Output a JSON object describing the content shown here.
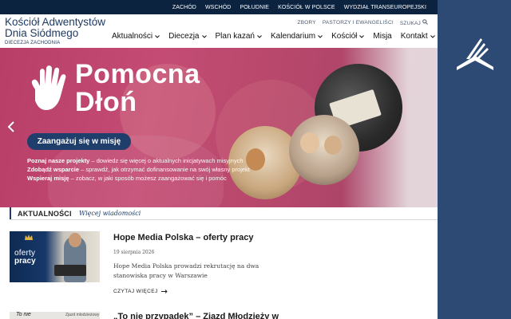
{
  "colors": {
    "navy": "#0c2340",
    "brand_blue": "#2c4a73",
    "hero_pink": "#c44c74",
    "cta_blue": "#1f3e6b"
  },
  "topbar": {
    "items": [
      "ZACHÓD",
      "WSCHÓD",
      "POŁUDNIE",
      "KOŚCIÓŁ W POLSCE",
      "WYDZIAŁ TRANSEUROPEJSKI"
    ]
  },
  "header": {
    "title_line1": "Kościół Adwentystów",
    "title_line2": "Dnia Siódmego",
    "subtitle": "DIECEZJA ZACHODNIA",
    "util": [
      "ZBORY",
      "PASTORZY I EWANGELIŚCI",
      "SZUKAJ"
    ],
    "search_icon": "search-icon",
    "nav": [
      {
        "label": "Aktualności",
        "dropdown": true
      },
      {
        "label": "Diecezja",
        "dropdown": true
      },
      {
        "label": "Plan kazań",
        "dropdown": true
      },
      {
        "label": "Kalendarium",
        "dropdown": true
      },
      {
        "label": "Kościół",
        "dropdown": true
      },
      {
        "label": "Misja",
        "dropdown": false
      },
      {
        "label": "Kontakt",
        "dropdown": true
      }
    ]
  },
  "hero": {
    "title_line1": "Pomocna",
    "title_line2": "Dłoń",
    "cta": "Zaangażuj się w misję",
    "bullets": [
      {
        "bold": "Poznaj nasze projekty",
        "rest": " – dowiedz się więcej o aktualnych inicjatywach misyjnych"
      },
      {
        "bold": "Zdobądź wsparcie",
        "rest": " – sprawdź, jak otrzymać dofinansowanie na swój własny projekt"
      },
      {
        "bold": "Wspieraj misję",
        "rest": " – zobacz, w jaki sposób możesz zaangażować się i pomóc"
      }
    ],
    "prev_icon": "chevron-left-icon"
  },
  "news": {
    "heading": "AKTUALNOŚCI",
    "more": "Więcej wiadomości",
    "articles": [
      {
        "thumb_line1": "oferty",
        "thumb_line2": "pracy",
        "title": "Hope Media Polska – oferty pracy",
        "date": "19 sierpnia 2026",
        "excerpt": "Hope Media Polska prowadzi rekrutację na dwa stanowiska pracy w Warszawie",
        "read_more": "CZYTAJ WIĘCEJ"
      },
      {
        "thumb_line1": "To nie",
        "thumb_line2": "Zjazd młodzieżowy",
        "title": "„To nie przypadek” – Zjazd Młodzieży w"
      }
    ]
  }
}
